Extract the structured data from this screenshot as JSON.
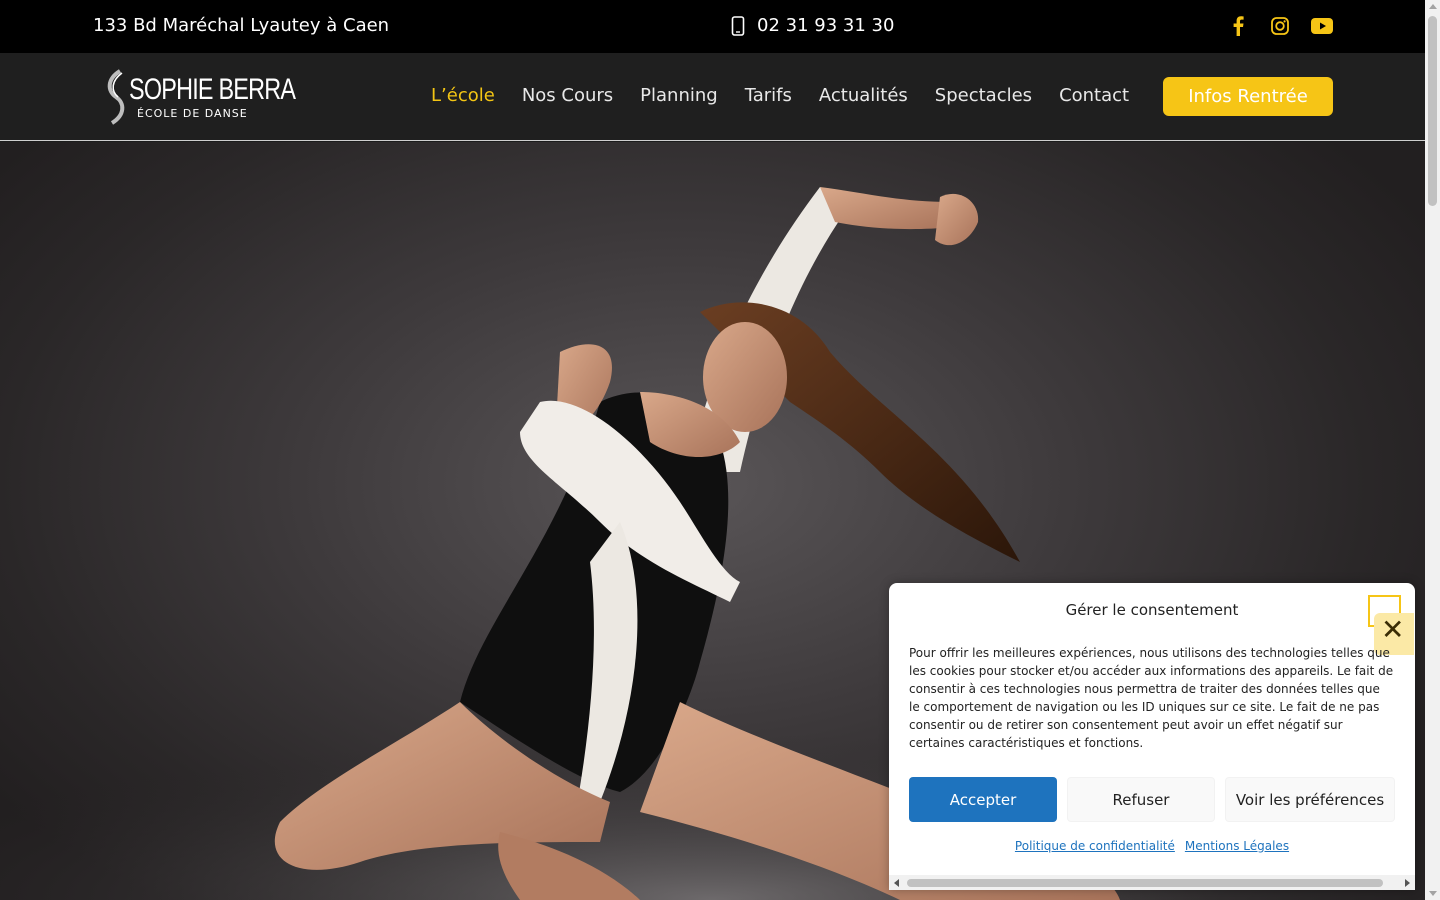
{
  "topbar": {
    "address": "133 Bd Maréchal Lyautey à Caen",
    "phone": "02 31 93 31 30",
    "social": [
      "facebook-icon",
      "instagram-icon",
      "youtube-icon"
    ]
  },
  "logo": {
    "name": "SOPHIE BERRA",
    "subtitle": "ÉCOLE DE DANSE"
  },
  "nav": {
    "items": [
      {
        "label": "L’école",
        "active": true
      },
      {
        "label": "Nos Cours"
      },
      {
        "label": "Planning"
      },
      {
        "label": "Tarifs"
      },
      {
        "label": "Actualités"
      },
      {
        "label": "Spectacles"
      },
      {
        "label": "Contact"
      }
    ],
    "cta": "Infos Rentrée"
  },
  "hero": {
    "image": "dancer-photo"
  },
  "consent": {
    "title": "Gérer le consentement",
    "text": "Pour offrir les meilleures expériences, nous utilisons des technologies telles que les cookies pour stocker et/ou accéder aux informations des appareils. Le fait de consentir à ces technologies nous permettra de traiter des données telles que le comportement de navigation ou les ID uniques sur ce site. Le fait de ne pas consentir ou de retirer son consentement peut avoir un effet négatif sur certaines caractéristiques et fonctions.",
    "accept": "Accepter",
    "refuse": "Refuser",
    "preferences": "Voir les préférences",
    "privacy_link": "Politique de confidentialité",
    "legal_link": "Mentions Légales"
  },
  "colors": {
    "accent": "#f6c516",
    "primary_button": "#1e73be",
    "topbar_bg": "#000000",
    "navbar_bg": "#1f1f1f"
  }
}
